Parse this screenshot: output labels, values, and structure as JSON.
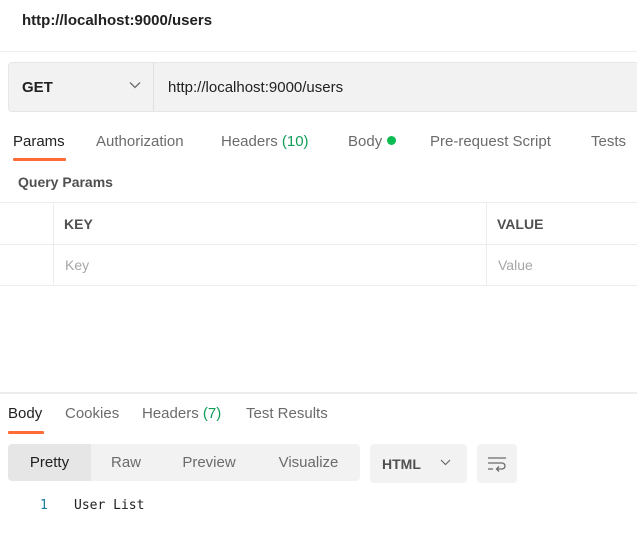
{
  "request": {
    "title": "http://localhost:9000/users",
    "method": "GET",
    "url": "http://localhost:9000/users"
  },
  "request_tabs": [
    {
      "label": "Params",
      "active": true
    },
    {
      "label": "Authorization"
    },
    {
      "label": "Headers",
      "count": "(10)"
    },
    {
      "label": "Body",
      "has_indicator": true
    },
    {
      "label": "Pre-request Script"
    },
    {
      "label": "Tests"
    }
  ],
  "query_params": {
    "section_label": "Query Params",
    "columns": [
      "KEY",
      "VALUE"
    ],
    "placeholders": {
      "key": "Key",
      "value": "Value"
    }
  },
  "response_tabs": [
    {
      "label": "Body",
      "active": true
    },
    {
      "label": "Cookies"
    },
    {
      "label": "Headers",
      "count": "(7)"
    },
    {
      "label": "Test Results"
    }
  ],
  "response_view": {
    "modes": [
      "Pretty",
      "Raw",
      "Preview",
      "Visualize"
    ],
    "active_mode": "Pretty",
    "format": "HTML"
  },
  "response_body": [
    {
      "line": "1",
      "text": "User List"
    }
  ],
  "colors": {
    "accent": "#ff6c37",
    "indicator": "#0cbb52",
    "count": "#0f9d58"
  }
}
